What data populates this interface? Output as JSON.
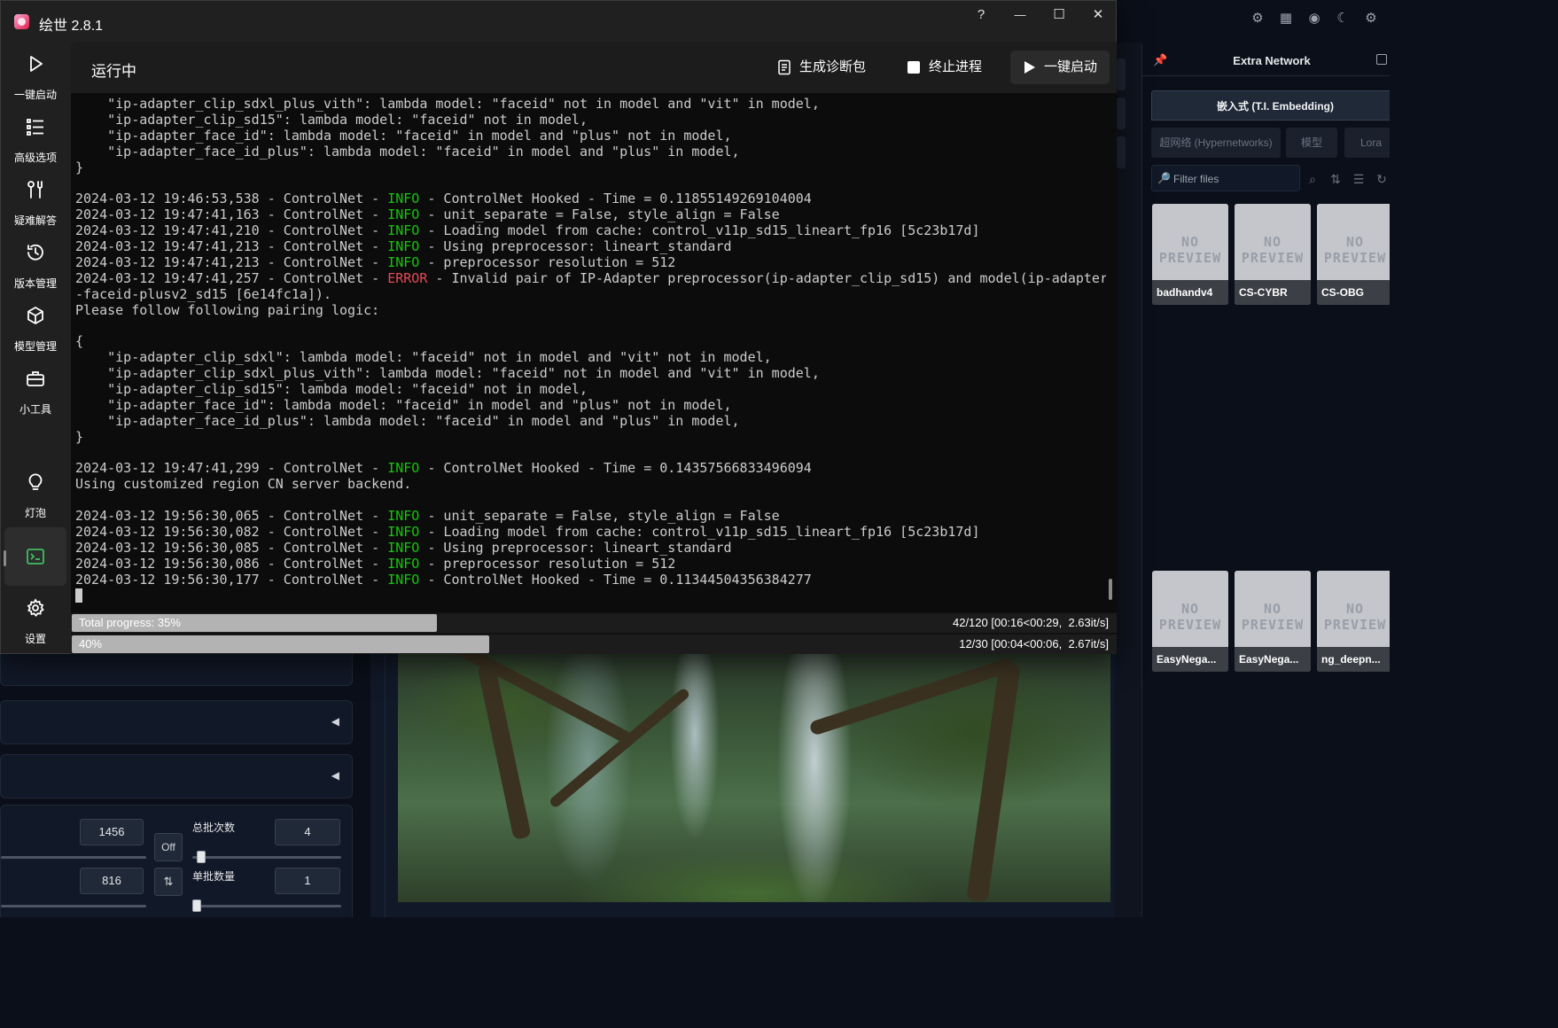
{
  "app": {
    "title": "绘世 2.8.1",
    "window_controls": {
      "help": "?",
      "minimize": "—",
      "maximize": "☐",
      "close": "✕"
    }
  },
  "sidebar": {
    "items": [
      {
        "label": "一键启动",
        "icon": "play-icon"
      },
      {
        "label": "高级选项",
        "icon": "list-icon"
      },
      {
        "label": "疑难解答",
        "icon": "tools-icon"
      },
      {
        "label": "版本管理",
        "icon": "history-icon"
      },
      {
        "label": "模型管理",
        "icon": "cube-icon"
      },
      {
        "label": "小工具",
        "icon": "toolbox-icon"
      },
      {
        "label": "灯泡",
        "icon": "lightbulb-icon"
      },
      {
        "label": "",
        "icon": "console-icon",
        "active": true
      },
      {
        "label": "设置",
        "icon": "gear-icon"
      }
    ]
  },
  "header": {
    "status": "运行中",
    "diagnostic_label": "生成诊断包",
    "stop_label": "终止进程",
    "launch_label": "一键启动"
  },
  "console": {
    "lines": [
      {
        "text": "    \"ip-adapter_clip_sdxl_plus_vith\": lambda model: \"faceid\" not in model and \"vit\" in model,"
      },
      {
        "text": "    \"ip-adapter_clip_sd15\": lambda model: \"faceid\" not in model,"
      },
      {
        "text": "    \"ip-adapter_face_id\": lambda model: \"faceid\" in model and \"plus\" not in model,"
      },
      {
        "text": "    \"ip-adapter_face_id_plus\": lambda model: \"faceid\" in model and \"plus\" in model,"
      },
      {
        "text": "}"
      },
      {
        "text": ""
      },
      {
        "pre": "2024-03-12 19:46:53,538 - ControlNet - ",
        "level": "INFO",
        "post": " - ControlNet Hooked - Time = 0.11855149269104004"
      },
      {
        "pre": "2024-03-12 19:47:41,163 - ControlNet - ",
        "level": "INFO",
        "post": " - unit_separate = False, style_align = False"
      },
      {
        "pre": "2024-03-12 19:47:41,210 - ControlNet - ",
        "level": "INFO",
        "post": " - Loading model from cache: control_v11p_sd15_lineart_fp16 [5c23b17d]"
      },
      {
        "pre": "2024-03-12 19:47:41,213 - ControlNet - ",
        "level": "INFO",
        "post": " - Using preprocessor: lineart_standard"
      },
      {
        "pre": "2024-03-12 19:47:41,213 - ControlNet - ",
        "level": "INFO",
        "post": " - preprocessor resolution = 512"
      },
      {
        "pre": "2024-03-12 19:47:41,257 - ControlNet - ",
        "level": "ERROR",
        "post": " - Invalid pair of IP-Adapter preprocessor(ip-adapter_clip_sd15) and model(ip-adapter"
      },
      {
        "text": "-faceid-plusv2_sd15 [6e14fc1a])."
      },
      {
        "text": "Please follow following pairing logic:"
      },
      {
        "text": ""
      },
      {
        "text": "{"
      },
      {
        "text": "    \"ip-adapter_clip_sdxl\": lambda model: \"faceid\" not in model and \"vit\" not in model,"
      },
      {
        "text": "    \"ip-adapter_clip_sdxl_plus_vith\": lambda model: \"faceid\" not in model and \"vit\" in model,"
      },
      {
        "text": "    \"ip-adapter_clip_sd15\": lambda model: \"faceid\" not in model,"
      },
      {
        "text": "    \"ip-adapter_face_id\": lambda model: \"faceid\" in model and \"plus\" not in model,"
      },
      {
        "text": "    \"ip-adapter_face_id_plus\": lambda model: \"faceid\" in model and \"plus\" in model,"
      },
      {
        "text": "}"
      },
      {
        "text": ""
      },
      {
        "pre": "2024-03-12 19:47:41,299 - ControlNet - ",
        "level": "INFO",
        "post": " - ControlNet Hooked - Time = 0.14357566833496094"
      },
      {
        "text": "Using customized region CN server backend."
      },
      {
        "text": ""
      },
      {
        "pre": "2024-03-12 19:56:30,065 - ControlNet - ",
        "level": "INFO",
        "post": " - unit_separate = False, style_align = False"
      },
      {
        "pre": "2024-03-12 19:56:30,082 - ControlNet - ",
        "level": "INFO",
        "post": " - Loading model from cache: control_v11p_sd15_lineart_fp16 [5c23b17d]"
      },
      {
        "pre": "2024-03-12 19:56:30,085 - ControlNet - ",
        "level": "INFO",
        "post": " - Using preprocessor: lineart_standard"
      },
      {
        "pre": "2024-03-12 19:56:30,086 - ControlNet - ",
        "level": "INFO",
        "post": " - preprocessor resolution = 512"
      },
      {
        "pre": "2024-03-12 19:56:30,177 - ControlNet - ",
        "level": "INFO",
        "post": " - ControlNet Hooked - Time = 0.11344504356384277"
      }
    ],
    "info_color": "#16c60c",
    "error_color": "#e74856"
  },
  "progress": {
    "total": {
      "label": "Total progress: 35%",
      "fraction": 0.35,
      "stats": "42/120 [00:16<00:29,  2.63it/s]"
    },
    "step": {
      "label": "40%",
      "fraction": 0.4,
      "stats": "12/30 [00:04<00:06,  2.67it/s]"
    }
  },
  "extra_network": {
    "title": "Extra Network",
    "active_tab": "嵌入式 (T.I. Embedding)",
    "tabs": [
      "超网络 (Hypernetworks)",
      "模型",
      "Lora"
    ],
    "filter_placeholder": "Filter files",
    "no_preview_text": "NO\nPREVIEW",
    "cards_row1": [
      "badhandv4",
      "CS-CYBR",
      "CS-OBG"
    ],
    "cards_row2": [
      "EasyNega...",
      "EasyNega...",
      "ng_deepn..."
    ]
  },
  "form": {
    "width_value": "1456",
    "height_value": "816",
    "off_label": "Off",
    "swap_icon": "⇅",
    "batch_count_label": "总批次数",
    "batch_count_value": "4",
    "batch_size_label": "单批数量",
    "batch_size_value": "1"
  }
}
